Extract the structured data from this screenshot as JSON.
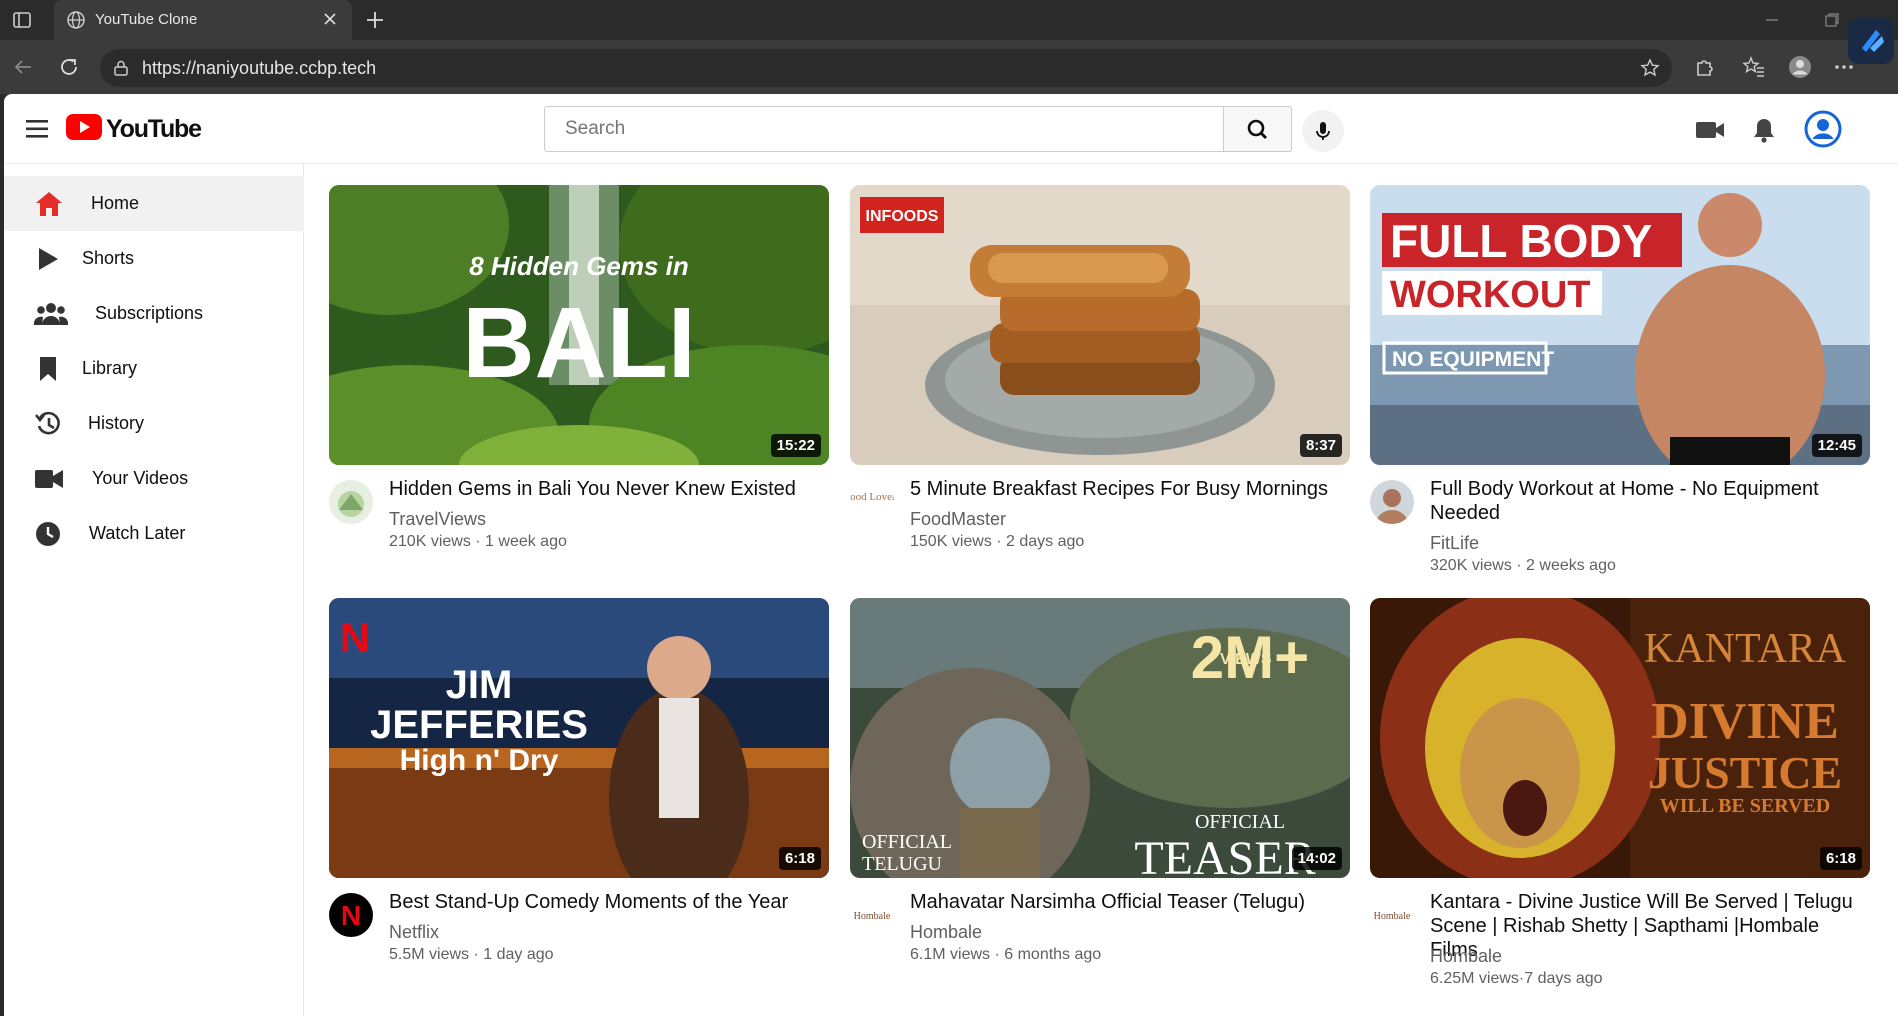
{
  "browser": {
    "tab_title": "YouTube Clone",
    "url": "https://naniyoutube.ccbp.tech"
  },
  "header": {
    "logo_text": "YouTube",
    "search_placeholder": "Search"
  },
  "sidebar": {
    "items": [
      {
        "label": "Home",
        "icon": "home-icon",
        "active": true
      },
      {
        "label": "Shorts",
        "icon": "play-icon"
      },
      {
        "label": "Subscriptions",
        "icon": "people-icon"
      },
      {
        "label": "Library",
        "icon": "bookmark-icon"
      },
      {
        "label": "History",
        "icon": "history-icon"
      },
      {
        "label": "Your Videos",
        "icon": "video-camera-icon"
      },
      {
        "label": "Watch Later",
        "icon": "clock-icon"
      }
    ]
  },
  "videos": [
    {
      "title": "Hidden Gems in Bali You Never Knew Existed",
      "channel": "TravelViews",
      "meta": "210K views · 1 week ago",
      "duration": "15:22",
      "thumb_text": [
        "8 Hidden Gems in",
        "BALI"
      ]
    },
    {
      "title": "5 Minute Breakfast Recipes For Busy Mornings",
      "channel": "FoodMaster",
      "meta": "150K views · 2 days ago",
      "duration": "8:37",
      "thumb_text": [
        "INFOODS"
      ],
      "avatar_text": "Food Lovers"
    },
    {
      "title": "Full Body Workout at Home - No Equipment Needed",
      "channel": "FitLife",
      "meta": "320K views · 2 weeks ago",
      "duration": "12:45",
      "thumb_text": [
        "FULL BODY",
        "WORKOUT",
        "NO EQUIPMENT"
      ]
    },
    {
      "title": "Best Stand-Up Comedy Moments of the Year",
      "channel": "Netflix",
      "meta": "5.5M views · 1 day ago",
      "duration": "6:18",
      "thumb_text": [
        "N",
        "JIM",
        "JEFFERIES",
        "High n' Dry"
      ],
      "avatar_text": "N"
    },
    {
      "title": "Mahavatar Narsimha Official Teaser (Telugu)",
      "channel": "Hombale",
      "meta": "6.1M views · 6 months ago",
      "duration": "14:02",
      "thumb_text": [
        "2M+",
        "VIEWS",
        "OFFICIAL",
        "TELUGU",
        "OFFICIAL",
        "TEASER"
      ],
      "avatar_text": "Hombale"
    },
    {
      "title": "Kantara - Divine Justice Will Be Served | Telugu Scene | Rishab Shetty | Sapthami |Hombale Films",
      "channel": "Hombale",
      "meta": "6.25M views·7 days ago",
      "duration": "6:18",
      "thumb_text": [
        "KANTARA",
        "DIVINE",
        "JUSTICE",
        "WILL BE SERVED"
      ],
      "avatar_text": "Hombale"
    }
  ]
}
